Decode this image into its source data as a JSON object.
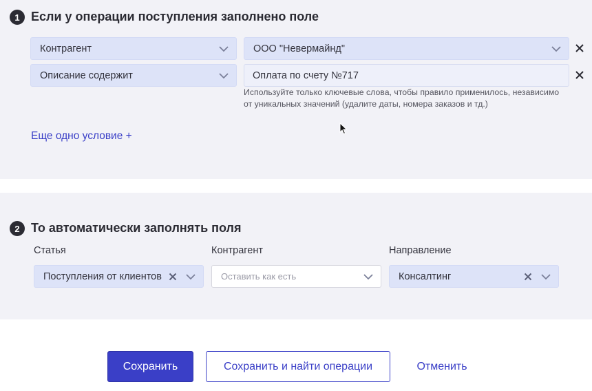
{
  "condition_section": {
    "step": "1",
    "title": "Если у операции поступления заполнено поле",
    "rows": [
      {
        "field": "Контрагент",
        "value": "ООО \"Невермайнд\""
      },
      {
        "field": "Описание содержит",
        "value": "Оплата по счету №717"
      }
    ],
    "hint": [
      "Используйте только ключевые слова, чтобы правило применилось, независимо",
      "от уникальных значений (удалите даты, номера заказов и тд.)"
    ],
    "add_condition_label": "Еще одно условие +"
  },
  "autofill_section": {
    "step": "2",
    "title": "То автоматически заполнять поля",
    "fields": [
      {
        "label": "Статья",
        "value": "Поступления от клиентов"
      },
      {
        "label": "Контрагент",
        "placeholder": "Оставить как есть"
      },
      {
        "label": "Направление",
        "value": "Консалтинг"
      }
    ]
  },
  "actions": {
    "save_label": "Сохранить",
    "save_find_label": "Сохранить и найти операции",
    "cancel_label": "Отменить"
  },
  "colors": {
    "accent": "#3a3fc7",
    "select_bg": "#dde3f8",
    "section_bg": "#f2f2f7"
  }
}
